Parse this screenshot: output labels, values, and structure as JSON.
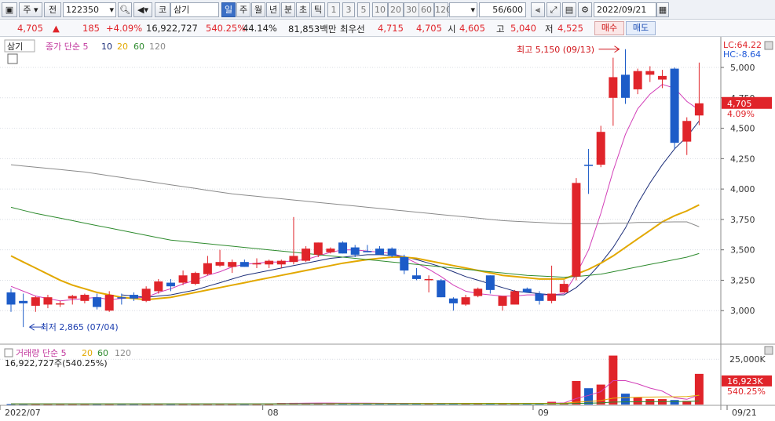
{
  "toolbar": {
    "market": "주",
    "prev": "전",
    "code": "122350",
    "mkt_label": "코",
    "stock_name": "삼기",
    "periods": [
      "일",
      "주",
      "월",
      "년",
      "분",
      "초",
      "틱"
    ],
    "active_period": "일",
    "intervals": [
      "1",
      "3",
      "5",
      "10",
      "20",
      "30",
      "60",
      "120"
    ],
    "count": "56/600",
    "date": "2022/09/21"
  },
  "info": {
    "price": "4,705",
    "arrow": "▲",
    "change": "185",
    "change_pct": "+4.09%",
    "volume": "16,922,727",
    "vol_ratio": "540.25%",
    "turnover": "44.14%",
    "amount": "81,853백만",
    "best_label": "최우선",
    "ask": "4,715",
    "bid": "4,705",
    "open_label": "시",
    "open": "4,605",
    "high_label": "고",
    "high": "5,040",
    "low_label": "저",
    "low": "4,525",
    "buy": "매수",
    "sell": "매도"
  },
  "price_panel": {
    "stock_tag": "삼기",
    "indicator_label": "종가 단순",
    "ma_periods": [
      "5",
      "10",
      "20",
      "60",
      "120"
    ],
    "lc": "LC:64.22",
    "hc": "HC:-8.64",
    "high_marker": "최고 5,150 (09/13)",
    "low_marker": "최저 2,865 (07/04)",
    "current_tag": "4,705",
    "current_pct": "4.09%"
  },
  "volume_panel": {
    "indicator_label": "거래량 단순",
    "ma_periods": [
      "5",
      "20",
      "60",
      "120"
    ],
    "value_text": "16,922,727주(540.25%)",
    "tag_value": "16,923K",
    "tag_pct": "540.25%"
  },
  "chart_data": {
    "type": "candlestick",
    "price_axis": {
      "ticks": [
        "3,000",
        "3,250",
        "3,500",
        "3,750",
        "4,000",
        "4,250",
        "4,500",
        "4,750",
        "5,000"
      ],
      "ymin": 2750,
      "ymax": 5200
    },
    "volume_axis": {
      "ticks": [
        "25,000K"
      ],
      "ymin": 0,
      "ymax": 32000
    },
    "x_labels": [
      {
        "i": 0,
        "label": "2022/07"
      },
      {
        "i": 21,
        "label": "08"
      },
      {
        "i": 43,
        "label": "09"
      },
      {
        "i": 58,
        "label": "09/21"
      }
    ],
    "candles": [
      {
        "o": 3150,
        "h": 3180,
        "l": 2990,
        "c": 3050
      },
      {
        "o": 3080,
        "h": 3140,
        "l": 2865,
        "c": 3060
      },
      {
        "o": 3040,
        "h": 3120,
        "l": 2990,
        "c": 3110
      },
      {
        "o": 3050,
        "h": 3130,
        "l": 3020,
        "c": 3110
      },
      {
        "o": 3050,
        "h": 3080,
        "l": 3030,
        "c": 3060
      },
      {
        "o": 3100,
        "h": 3130,
        "l": 3050,
        "c": 3120
      },
      {
        "o": 3080,
        "h": 3140,
        "l": 3060,
        "c": 3130
      },
      {
        "o": 3110,
        "h": 3140,
        "l": 3010,
        "c": 3030
      },
      {
        "o": 3000,
        "h": 3160,
        "l": 2990,
        "c": 3130
      },
      {
        "o": 3110,
        "h": 3140,
        "l": 3050,
        "c": 3100
      },
      {
        "o": 3130,
        "h": 3150,
        "l": 3080,
        "c": 3100
      },
      {
        "o": 3080,
        "h": 3200,
        "l": 3070,
        "c": 3180
      },
      {
        "o": 3160,
        "h": 3260,
        "l": 3140,
        "c": 3240
      },
      {
        "o": 3230,
        "h": 3260,
        "l": 3160,
        "c": 3200
      },
      {
        "o": 3230,
        "h": 3330,
        "l": 3210,
        "c": 3290
      },
      {
        "o": 3220,
        "h": 3320,
        "l": 3210,
        "c": 3310
      },
      {
        "o": 3300,
        "h": 3450,
        "l": 3290,
        "c": 3390
      },
      {
        "o": 3370,
        "h": 3500,
        "l": 3360,
        "c": 3400
      },
      {
        "o": 3360,
        "h": 3420,
        "l": 3310,
        "c": 3400
      },
      {
        "o": 3400,
        "h": 3420,
        "l": 3360,
        "c": 3360
      },
      {
        "o": 3380,
        "h": 3430,
        "l": 3350,
        "c": 3390
      },
      {
        "o": 3380,
        "h": 3420,
        "l": 3350,
        "c": 3410
      },
      {
        "o": 3380,
        "h": 3420,
        "l": 3350,
        "c": 3410
      },
      {
        "o": 3400,
        "h": 3770,
        "l": 3380,
        "c": 3450
      },
      {
        "o": 3410,
        "h": 3530,
        "l": 3400,
        "c": 3510
      },
      {
        "o": 3460,
        "h": 3560,
        "l": 3440,
        "c": 3560
      },
      {
        "o": 3480,
        "h": 3520,
        "l": 3470,
        "c": 3510
      },
      {
        "o": 3560,
        "h": 3570,
        "l": 3470,
        "c": 3470
      },
      {
        "o": 3520,
        "h": 3540,
        "l": 3440,
        "c": 3460
      },
      {
        "o": 3490,
        "h": 3540,
        "l": 3480,
        "c": 3480
      },
      {
        "o": 3510,
        "h": 3530,
        "l": 3460,
        "c": 3460
      },
      {
        "o": 3510,
        "h": 3520,
        "l": 3440,
        "c": 3450
      },
      {
        "o": 3440,
        "h": 3460,
        "l": 3300,
        "c": 3330
      },
      {
        "o": 3290,
        "h": 3350,
        "l": 3250,
        "c": 3260
      },
      {
        "o": 3250,
        "h": 3290,
        "l": 3150,
        "c": 3260
      },
      {
        "o": 3250,
        "h": 3260,
        "l": 3110,
        "c": 3110
      },
      {
        "o": 3100,
        "h": 3110,
        "l": 3000,
        "c": 3060
      },
      {
        "o": 3050,
        "h": 3130,
        "l": 3040,
        "c": 3110
      },
      {
        "o": 3120,
        "h": 3190,
        "l": 3110,
        "c": 3180
      },
      {
        "o": 3290,
        "h": 3290,
        "l": 3140,
        "c": 3170
      },
      {
        "o": 3040,
        "h": 3090,
        "l": 3000,
        "c": 3120
      },
      {
        "o": 3050,
        "h": 3170,
        "l": 3050,
        "c": 3160
      },
      {
        "o": 3180,
        "h": 3190,
        "l": 3150,
        "c": 3150
      },
      {
        "o": 3140,
        "h": 3160,
        "l": 3050,
        "c": 3080
      },
      {
        "o": 3080,
        "h": 3370,
        "l": 3060,
        "c": 3140
      },
      {
        "o": 3150,
        "h": 3250,
        "l": 3150,
        "c": 3220
      },
      {
        "o": 3280,
        "h": 4090,
        "l": 3250,
        "c": 4050
      },
      {
        "o": 4200,
        "h": 4330,
        "l": 3960,
        "c": 4190
      },
      {
        "o": 4200,
        "h": 4520,
        "l": 4180,
        "c": 4470
      },
      {
        "o": 4750,
        "h": 5080,
        "l": 4520,
        "c": 4920
      },
      {
        "o": 4940,
        "h": 5150,
        "l": 4700,
        "c": 4750
      },
      {
        "o": 4820,
        "h": 4990,
        "l": 4780,
        "c": 4970
      },
      {
        "o": 4940,
        "h": 5010,
        "l": 4880,
        "c": 4970
      },
      {
        "o": 4900,
        "h": 4980,
        "l": 4830,
        "c": 4930
      },
      {
        "o": 4990,
        "h": 5000,
        "l": 4330,
        "c": 4380
      },
      {
        "o": 4390,
        "h": 4590,
        "l": 4280,
        "c": 4560
      },
      {
        "o": 4605,
        "h": 5040,
        "l": 4525,
        "c": 4705
      }
    ],
    "volumes": [
      300,
      300,
      300,
      300,
      300,
      300,
      300,
      300,
      300,
      300,
      300,
      300,
      300,
      300,
      300,
      300,
      300,
      300,
      300,
      300,
      300,
      300,
      800,
      900,
      800,
      800,
      800,
      800,
      700,
      700,
      700,
      600,
      600,
      600,
      600,
      600,
      600,
      600,
      600,
      600,
      600,
      600,
      600,
      600,
      1500,
      1000,
      13000,
      9000,
      11000,
      27000,
      6000,
      4000,
      3000,
      3000,
      2500,
      2000,
      16923
    ],
    "ma": [
      {
        "period": "5",
        "color": "#d23fb8",
        "values": [
          3200,
          3160,
          3120,
          3100,
          3080,
          3090,
          3100,
          3110,
          3090,
          3100,
          3105,
          3110,
          3150,
          3180,
          3220,
          3250,
          3290,
          3320,
          3360,
          3380,
          3390,
          3400,
          3400,
          3410,
          3420,
          3450,
          3480,
          3500,
          3500,
          3490,
          3480,
          3470,
          3440,
          3390,
          3340,
          3280,
          3210,
          3160,
          3140,
          3130,
          3120,
          3120,
          3130,
          3130,
          3130,
          3140,
          3300,
          3500,
          3800,
          4150,
          4450,
          4660,
          4780,
          4860,
          4830,
          4720,
          4650
        ]
      },
      {
        "period": "10",
        "color": "#1b2d78",
        "values": [
          null,
          null,
          null,
          null,
          null,
          null,
          null,
          null,
          null,
          3130,
          3120,
          3110,
          3120,
          3130,
          3150,
          3170,
          3200,
          3230,
          3260,
          3290,
          3310,
          3330,
          3350,
          3370,
          3390,
          3410,
          3430,
          3440,
          3450,
          3460,
          3460,
          3455,
          3445,
          3420,
          3390,
          3360,
          3320,
          3280,
          3250,
          3220,
          3190,
          3160,
          3150,
          3140,
          3130,
          3130,
          3190,
          3280,
          3390,
          3520,
          3680,
          3880,
          4050,
          4200,
          4330,
          4430,
          4560
        ]
      },
      {
        "period": "20",
        "color": "#e2a800",
        "values": [
          3450,
          3400,
          3350,
          3300,
          3250,
          3210,
          3180,
          3150,
          3130,
          3110,
          3100,
          3090,
          3100,
          3110,
          3130,
          3150,
          3170,
          3190,
          3210,
          3230,
          3250,
          3270,
          3290,
          3310,
          3330,
          3350,
          3370,
          3390,
          3405,
          3420,
          3430,
          3440,
          3440,
          3430,
          3410,
          3390,
          3370,
          3350,
          3330,
          3310,
          3290,
          3280,
          3270,
          3260,
          3260,
          3260,
          3300,
          3340,
          3390,
          3450,
          3520,
          3590,
          3660,
          3730,
          3780,
          3820,
          3870
        ]
      },
      {
        "period": "60",
        "color": "#2e8b2e",
        "values": [
          3850,
          3825,
          3800,
          3780,
          3760,
          3740,
          3720,
          3700,
          3680,
          3660,
          3640,
          3620,
          3600,
          3580,
          3570,
          3560,
          3550,
          3540,
          3530,
          3520,
          3510,
          3500,
          3490,
          3480,
          3470,
          3460,
          3450,
          3440,
          3430,
          3420,
          3410,
          3400,
          3390,
          3380,
          3370,
          3360,
          3350,
          3340,
          3330,
          3320,
          3310,
          3300,
          3290,
          3285,
          3280,
          3275,
          3280,
          3290,
          3300,
          3320,
          3340,
          3360,
          3380,
          3400,
          3420,
          3440,
          3470
        ]
      },
      {
        "period": "120",
        "color": "#8a8a8a",
        "values": [
          4200,
          4190,
          4180,
          4170,
          4160,
          4150,
          4140,
          4125,
          4110,
          4095,
          4080,
          4065,
          4050,
          4035,
          4020,
          4005,
          3990,
          3975,
          3960,
          3950,
          3940,
          3930,
          3920,
          3910,
          3900,
          3890,
          3880,
          3870,
          3860,
          3850,
          3840,
          3830,
          3820,
          3810,
          3800,
          3790,
          3780,
          3770,
          3760,
          3750,
          3740,
          3735,
          3730,
          3725,
          3720,
          3715,
          3715,
          3715,
          3715,
          3720,
          3720,
          3725,
          3725,
          3728,
          3730,
          3730,
          3690
        ]
      }
    ],
    "vol_ma": [
      {
        "period": "5",
        "color": "#d23fb8",
        "values": [
          300,
          300,
          300,
          300,
          300,
          300,
          300,
          300,
          300,
          300,
          300,
          300,
          300,
          300,
          300,
          300,
          300,
          300,
          300,
          300,
          300,
          400,
          520,
          650,
          760,
          820,
          800,
          790,
          760,
          730,
          700,
          670,
          640,
          620,
          600,
          600,
          600,
          600,
          600,
          600,
          600,
          600,
          600,
          600,
          780,
          860,
          3320,
          5080,
          7100,
          13200,
          13200,
          11400,
          9100,
          7400,
          3700,
          2900,
          5300
        ]
      },
      {
        "period": "20",
        "color": "#e2a800",
        "values": [
          300,
          300,
          300,
          300,
          300,
          300,
          300,
          300,
          300,
          300,
          300,
          300,
          300,
          300,
          300,
          300,
          300,
          300,
          300,
          300,
          300,
          320,
          350,
          380,
          410,
          440,
          470,
          500,
          520,
          540,
          560,
          570,
          580,
          590,
          600,
          610,
          620,
          630,
          640,
          640,
          640,
          640,
          640,
          630,
          670,
          700,
          1300,
          1700,
          2200,
          3500,
          3800,
          4000,
          4100,
          4200,
          4300,
          4400,
          5100
        ]
      },
      {
        "period": "60",
        "color": "#2e8b2e",
        "values": [
          400,
          400,
          400,
          400,
          400,
          400,
          400,
          400,
          400,
          400,
          400,
          400,
          400,
          400,
          400,
          400,
          400,
          400,
          400,
          400,
          400,
          400,
          400,
          400,
          400,
          400,
          400,
          400,
          400,
          400,
          400,
          400,
          400,
          400,
          400,
          400,
          400,
          400,
          400,
          400,
          400,
          400,
          400,
          400,
          420,
          430,
          600,
          750,
          900,
          1350,
          1450,
          1500,
          1550,
          1600,
          1650,
          1700,
          1950
        ]
      }
    ]
  },
  "colors": {
    "up": "#e0242a",
    "down": "#1d5cc8",
    "grid": "#d8dce3",
    "axis": "#333333"
  }
}
